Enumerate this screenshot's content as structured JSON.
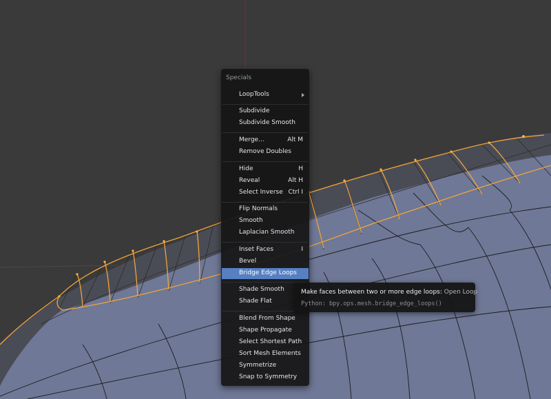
{
  "menu": {
    "title": "Specials",
    "items": [
      {
        "label": "LoopTools",
        "shortcut": "",
        "submenu": true
      },
      {
        "label": "Subdivide",
        "shortcut": ""
      },
      {
        "label": "Subdivide Smooth",
        "shortcut": ""
      },
      {
        "label": "Merge...",
        "shortcut": "Alt M"
      },
      {
        "label": "Remove Doubles",
        "shortcut": ""
      },
      {
        "label": "Hide",
        "shortcut": "H"
      },
      {
        "label": "Reveal",
        "shortcut": "Alt H"
      },
      {
        "label": "Select Inverse",
        "shortcut": "Ctrl I"
      },
      {
        "label": "Flip Normals",
        "shortcut": ""
      },
      {
        "label": "Smooth",
        "shortcut": ""
      },
      {
        "label": "Laplacian Smooth",
        "shortcut": ""
      },
      {
        "label": "Inset Faces",
        "shortcut": "I"
      },
      {
        "label": "Bevel",
        "shortcut": ""
      },
      {
        "label": "Bridge Edge Loops",
        "shortcut": "",
        "active": true
      },
      {
        "label": "Shade Smooth",
        "shortcut": ""
      },
      {
        "label": "Shade Flat",
        "shortcut": ""
      },
      {
        "label": "Blend From Shape",
        "shortcut": ""
      },
      {
        "label": "Shape Propagate",
        "shortcut": ""
      },
      {
        "label": "Select Shortest Path",
        "shortcut": ""
      },
      {
        "label": "Sort Mesh Elements",
        "shortcut": ""
      },
      {
        "label": "Symmetrize",
        "shortcut": ""
      },
      {
        "label": "Snap to Symmetry",
        "shortcut": ""
      }
    ]
  },
  "tooltip": {
    "description": "Make faces between two or more edge loops:",
    "value": "Open Loop",
    "python": "Python: bpy.ops.mesh.bridge_edge_loops()"
  },
  "colors": {
    "background": "#3a3a3a",
    "mesh_face": "#6f7896",
    "mesh_edge": "#1b1b1b",
    "selected_edge": "#f2a53a",
    "menu_bg": "#151515",
    "highlight": "#5680c2"
  }
}
